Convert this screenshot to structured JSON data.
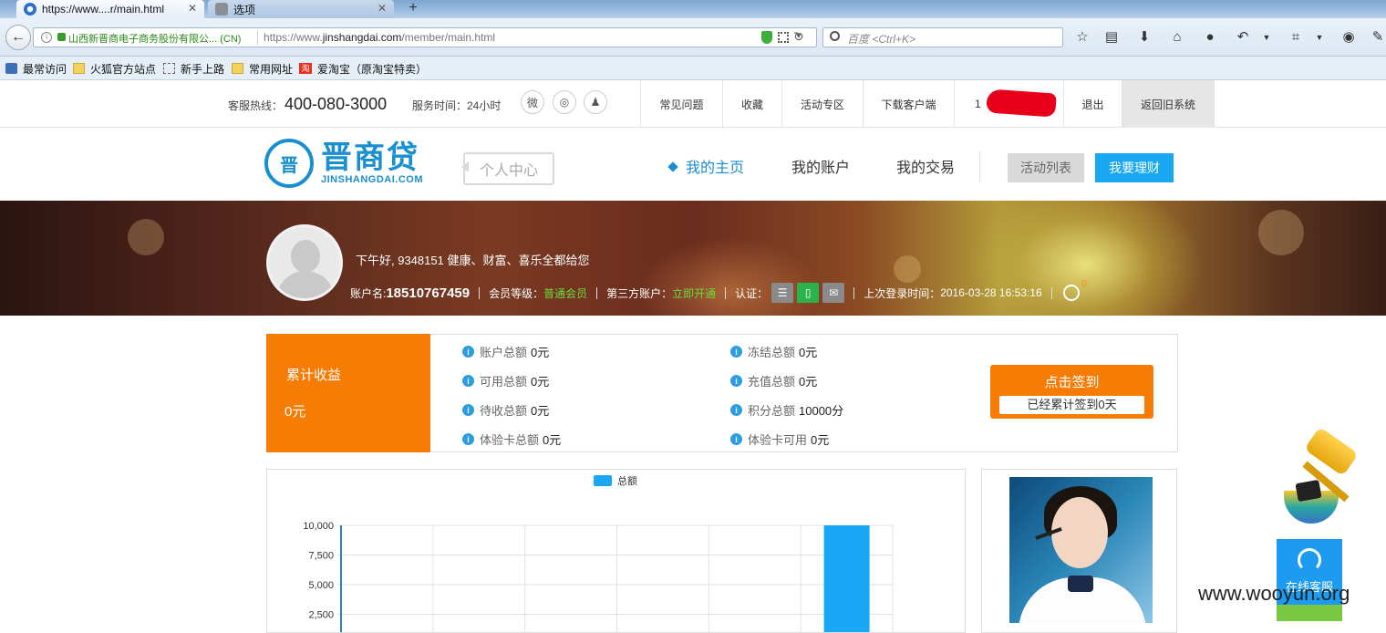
{
  "browser": {
    "tabs": [
      {
        "label": "https://www....r/main.html",
        "active": true
      },
      {
        "label": "选项",
        "active": false
      }
    ],
    "new_tab": "+",
    "identity": "山西新晋商电子商务股份有限公... (CN)",
    "url_prefix": "https://www.",
    "url_domain": "jinshangdai.com",
    "url_path": "/member/main.html",
    "search_placeholder": "百度 <Ctrl+K>",
    "bookmarks": [
      "最常访问",
      "火狐官方站点",
      "新手上路",
      "常用网址",
      "爱淘宝（原淘宝特卖）"
    ],
    "bookmark_badge": "淘"
  },
  "topbar": {
    "hotline_label": "客服热线：",
    "hotline_number": "400-080-3000",
    "service_time": "服务时间：24小时",
    "links": [
      "常见问题",
      "收藏",
      "活动专区",
      "下载客户端",
      "1",
      "退出",
      "返回旧系统"
    ]
  },
  "logo": {
    "mark": "晋",
    "cn": "晋商贷",
    "en": "JINSHANGDAI.COM"
  },
  "nav": {
    "personal_center": "个人中心",
    "items": [
      "我的主页",
      "我的账户",
      "我的交易"
    ],
    "activity_list": "活动列表",
    "invest": "我要理财"
  },
  "profile": {
    "greeting": "下午好, 9348151 健康、财富、喜乐全都给您",
    "account_label": "账户名:",
    "account": "18510767459",
    "level_label": "会员等级：",
    "level": "普通会员",
    "third_label": "第三方账户：",
    "third_value": "立即开通",
    "cert_label": "认证：",
    "last_login_label": "上次登录时间：",
    "last_login": "2016-03-28 16:53:16",
    "notif_count": "0"
  },
  "stats": {
    "cumulative_label": "累计收益",
    "cumulative_value": "0元",
    "items": [
      {
        "label": "账户总额",
        "value": "0元"
      },
      {
        "label": "冻结总额",
        "value": "0元"
      },
      {
        "label": "可用总额",
        "value": "0元"
      },
      {
        "label": "充值总额",
        "value": "0元"
      },
      {
        "label": "待收总额",
        "value": "0元"
      },
      {
        "label": "积分总额",
        "value": "10000分"
      },
      {
        "label": "体验卡总额",
        "value": "0元"
      },
      {
        "label": "体验卡可用",
        "value": "0元"
      }
    ],
    "sign_title": "点击签到",
    "sign_sub": "已经累计签到0天"
  },
  "chart_data": {
    "type": "bar",
    "series": [
      {
        "name": "总额",
        "values": [
          0,
          0,
          0,
          0,
          0,
          10000
        ]
      }
    ],
    "categories": [
      "",
      "",
      "",
      "",
      "",
      ""
    ],
    "y_ticks": [
      "10,000",
      "7,500",
      "5,000",
      "2,500"
    ],
    "ylim": [
      0,
      10000
    ],
    "legend": "top-center",
    "grid": true,
    "color": "#1aa7f5"
  },
  "float": {
    "online_service": "在线客服"
  },
  "watermark": "www.wooyun.org",
  "colors": {
    "brand_blue": "#1a8fd0",
    "orange": "#f77c06",
    "invest_blue": "#19a7f2",
    "green_text": "#6cdb3a"
  }
}
